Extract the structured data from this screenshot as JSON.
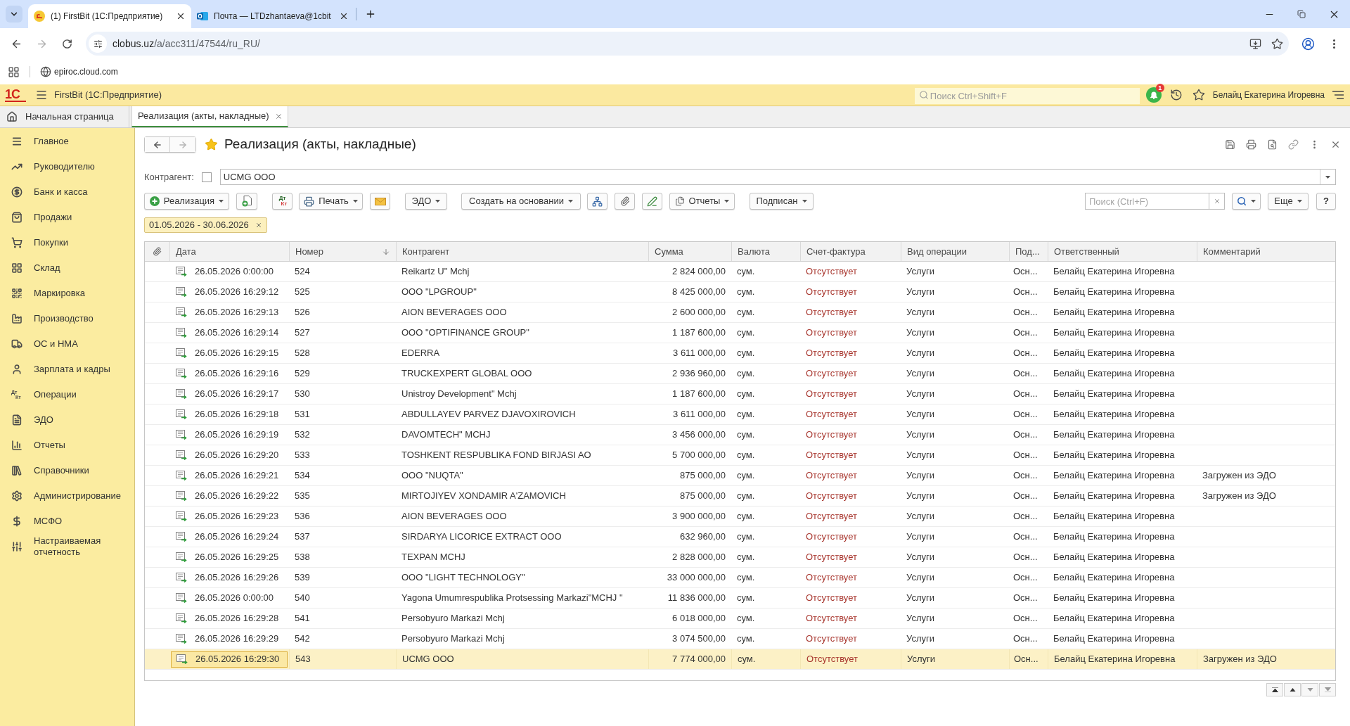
{
  "browser": {
    "tabs": [
      {
        "title": "(1) FirstBit (1С:Предприятие)",
        "selected": true,
        "kind": "app"
      },
      {
        "title": "Почта — LTDzhantaeva@1cbit",
        "selected": false,
        "kind": "mail"
      }
    ],
    "address": {
      "host": "clobus.uz",
      "path": "/a/acc311/47544/ru_RU/"
    },
    "bookmarks": [
      {
        "label": "epiroc.cloud.com"
      }
    ]
  },
  "app_header": {
    "logo": "1С",
    "title": "FirstBit (1С:Предприятие)",
    "search": {
      "placeholder": "Поиск Ctrl+Shift+F"
    },
    "notifications": "1",
    "user": "Белайц Екатерина Игоревна"
  },
  "section_tabs": [
    {
      "label": "Начальная страница",
      "kind": "home",
      "selected": false
    },
    {
      "label": "Реализация (акты, накладные)",
      "kind": "form",
      "selected": true
    }
  ],
  "sidebar": {
    "items": [
      {
        "label": "Главное"
      },
      {
        "label": "Руководителю"
      },
      {
        "label": "Банк и касса"
      },
      {
        "label": "Продажи"
      },
      {
        "label": "Покупки"
      },
      {
        "label": "Склад"
      },
      {
        "label": "Маркировка"
      },
      {
        "label": "Производство"
      },
      {
        "label": "ОС и НМА"
      },
      {
        "label": "Зарплата и кадры"
      },
      {
        "label": "Операции",
        "icon_text": [
          "Дт",
          "Кт"
        ]
      },
      {
        "label": "ЭДО"
      },
      {
        "label": "Отчеты"
      },
      {
        "label": "Справочники"
      },
      {
        "label": "Администрирование"
      },
      {
        "label": "МСФО"
      },
      {
        "label": "Настраиваемая отчетность"
      }
    ]
  },
  "form": {
    "title": "Реализация (акты, накладные)",
    "favorite": true,
    "counterparty": {
      "label": "Контрагент:",
      "checked": false,
      "value": "UCMG OOO"
    },
    "toolbar": {
      "create": "Реализация",
      "ledger": [
        "Дт",
        "Кт"
      ],
      "print": "Печать",
      "edo": "ЭДО",
      "based_on": "Создать на основании",
      "reports": "Отчеты",
      "signed": "Подписан",
      "search": {
        "placeholder": "Поиск (Ctrl+F)"
      },
      "more": "Еще",
      "help": "?"
    },
    "filter": {
      "period": "01.05.2026 - 30.06.2026"
    },
    "table": {
      "columns": [
        {
          "label": "Дата",
          "sorted": false
        },
        {
          "label": "Номер",
          "sorted": true
        },
        {
          "label": "Контрагент",
          "sorted": false
        },
        {
          "label": "Сумма",
          "sorted": false
        },
        {
          "label": "Валюта",
          "sorted": false
        },
        {
          "label": "Счет-фактура",
          "sorted": false
        },
        {
          "label": "Вид операции",
          "sorted": false
        },
        {
          "label": "Под...",
          "sorted": false
        },
        {
          "label": "Ответственный",
          "sorted": false
        },
        {
          "label": "Комментарий",
          "sorted": false
        }
      ],
      "rows": [
        {
          "date": "26.05.2026 0:00:00",
          "number": "524",
          "counterparty": "Reikartz U\" Mchj",
          "amount": "2 824 000,00",
          "currency": "сум.",
          "invoice": "Отсутствует",
          "operation": "Услуги",
          "column_9": "Осн...",
          "responsible": "Белайц Екатерина Игоревна",
          "selected": false
        },
        {
          "date": "26.05.2026 16:29:12",
          "number": "525",
          "counterparty": "OOO \"LPGROUP\"",
          "amount": "8 425 000,00",
          "currency": "сум.",
          "invoice": "Отсутствует",
          "operation": "Услуги",
          "column_9": "Осн...",
          "responsible": "Белайц Екатерина Игоревна",
          "selected": false
        },
        {
          "date": "26.05.2026 16:29:13",
          "number": "526",
          "counterparty": "AION BEVERAGES OOO",
          "amount": "2 600 000,00",
          "currency": "сум.",
          "invoice": "Отсутствует",
          "operation": "Услуги",
          "column_9": "Осн...",
          "responsible": "Белайц Екатерина Игоревна",
          "selected": false
        },
        {
          "date": "26.05.2026 16:29:14",
          "number": "527",
          "counterparty": "OOO \"OPTIFINANCE GROUP\"",
          "amount": "1 187 600,00",
          "currency": "сум.",
          "invoice": "Отсутствует",
          "operation": "Услуги",
          "column_9": "Осн...",
          "responsible": "Белайц Екатерина Игоревна",
          "selected": false
        },
        {
          "date": "26.05.2026 16:29:15",
          "number": "528",
          "counterparty": "EDERRA",
          "amount": "3 611 000,00",
          "currency": "сум.",
          "invoice": "Отсутствует",
          "operation": "Услуги",
          "column_9": "Осн...",
          "responsible": "Белайц Екатерина Игоревна",
          "selected": false
        },
        {
          "date": "26.05.2026 16:29:16",
          "number": "529",
          "counterparty": "TRUCKEXPERT GLOBAL OOO",
          "amount": "2 936 960,00",
          "currency": "сум.",
          "invoice": "Отсутствует",
          "operation": "Услуги",
          "column_9": "Осн...",
          "responsible": "Белайц Екатерина Игоревна",
          "selected": false
        },
        {
          "date": "26.05.2026 16:29:17",
          "number": "530",
          "counterparty": "Unistroy Development\" Mchj",
          "amount": "1 187 600,00",
          "currency": "сум.",
          "invoice": "Отсутствует",
          "operation": "Услуги",
          "column_9": "Осн...",
          "responsible": "Белайц Екатерина Игоревна",
          "selected": false
        },
        {
          "date": "26.05.2026 16:29:18",
          "number": "531",
          "counterparty": "ABDULLAYEV PARVEZ DJAVOXIROVICH",
          "amount": "3 611 000,00",
          "currency": "сум.",
          "invoice": "Отсутствует",
          "operation": "Услуги",
          "column_9": "Осн...",
          "responsible": "Белайц Екатерина Игоревна",
          "selected": false
        },
        {
          "date": "26.05.2026 16:29:19",
          "number": "532",
          "counterparty": "DAVOMTECH\" MCHJ",
          "amount": "3 456 000,00",
          "currency": "сум.",
          "invoice": "Отсутствует",
          "operation": "Услуги",
          "column_9": "Осн...",
          "responsible": "Белайц Екатерина Игоревна",
          "selected": false
        },
        {
          "date": "26.05.2026 16:29:20",
          "number": "533",
          "counterparty": "TOSHKENT RESPUBLIKA FOND BIRJASI AO",
          "amount": "5 700 000,00",
          "currency": "сум.",
          "invoice": "Отсутствует",
          "operation": "Услуги",
          "column_9": "Осн...",
          "responsible": "Белайц Екатерина Игоревна",
          "selected": false
        },
        {
          "date": "26.05.2026 16:29:21",
          "number": "534",
          "counterparty": "OOO \"NUQTA\"",
          "amount": "875 000,00",
          "currency": "сум.",
          "invoice": "Отсутствует",
          "operation": "Услуги",
          "column_9": "Осн...",
          "responsible": "Белайц Екатерина Игоревна",
          "comment": "Загружен из ЭДО",
          "selected": false
        },
        {
          "date": "26.05.2026 16:29:22",
          "number": "535",
          "counterparty": "MIRTOJIYEV XONDAMIR A'ZAMOVICH",
          "amount": "875 000,00",
          "currency": "сум.",
          "invoice": "Отсутствует",
          "operation": "Услуги",
          "column_9": "Осн...",
          "responsible": "Белайц Екатерина Игоревна",
          "comment": "Загружен из ЭДО",
          "selected": false
        },
        {
          "date": "26.05.2026 16:29:23",
          "number": "536",
          "counterparty": "AION BEVERAGES OOO",
          "amount": "3 900 000,00",
          "currency": "сум.",
          "invoice": "Отсутствует",
          "operation": "Услуги",
          "column_9": "Осн...",
          "responsible": "Белайц Екатерина Игоревна",
          "selected": false
        },
        {
          "date": "26.05.2026 16:29:24",
          "number": "537",
          "counterparty": "SIRDARYA LICORICE EXTRACT OOO",
          "amount": "632 960,00",
          "currency": "сум.",
          "invoice": "Отсутствует",
          "operation": "Услуги",
          "column_9": "Осн...",
          "responsible": "Белайц Екатерина Игоревна",
          "selected": false
        },
        {
          "date": "26.05.2026 16:29:25",
          "number": "538",
          "counterparty": "TEXPAN MCHJ",
          "amount": "2 828 000,00",
          "currency": "сум.",
          "invoice": "Отсутствует",
          "operation": "Услуги",
          "column_9": "Осн...",
          "responsible": "Белайц Екатерина Игоревна",
          "selected": false
        },
        {
          "date": "26.05.2026 16:29:26",
          "number": "539",
          "counterparty": "OOO \"LIGHT TECHNOLOGY\"",
          "amount": "33 000 000,00",
          "currency": "сум.",
          "invoice": "Отсутствует",
          "operation": "Услуги",
          "column_9": "Осн...",
          "responsible": "Белайц Екатерина Игоревна",
          "selected": false
        },
        {
          "date": "26.05.2026 0:00:00",
          "number": "540",
          "counterparty": "Yagona Umumrespublika Protsessing Markazi\"MCHJ \"",
          "amount": "11 836 000,00",
          "currency": "сум.",
          "invoice": "Отсутствует",
          "operation": "Услуги",
          "column_9": "Осн...",
          "responsible": "Белайц Екатерина Игоревна",
          "selected": false
        },
        {
          "date": "26.05.2026 16:29:28",
          "number": "541",
          "counterparty": "Persobyuro Markazi Mchj",
          "amount": "6 018 000,00",
          "currency": "сум.",
          "invoice": "Отсутствует",
          "operation": "Услуги",
          "column_9": "Осн...",
          "responsible": "Белайц Екатерина Игоревна",
          "selected": false
        },
        {
          "date": "26.05.2026 16:29:29",
          "number": "542",
          "counterparty": "Persobyuro Markazi Mchj",
          "amount": "3 074 500,00",
          "currency": "сум.",
          "invoice": "Отсутствует",
          "operation": "Услуги",
          "column_9": "Осн...",
          "responsible": "Белайц Екатерина Игоревна",
          "selected": false
        },
        {
          "date": "26.05.2026 16:29:30",
          "number": "543",
          "counterparty": "UCMG OOO",
          "amount": "7 774 000,00",
          "currency": "сум.",
          "invoice": "Отсутствует",
          "operation": "Услуги",
          "column_9": "Осн...",
          "responsible": "Белайц Екатерина Игоревна",
          "comment": "Загружен из ЭДО",
          "selected": true
        }
      ]
    }
  }
}
